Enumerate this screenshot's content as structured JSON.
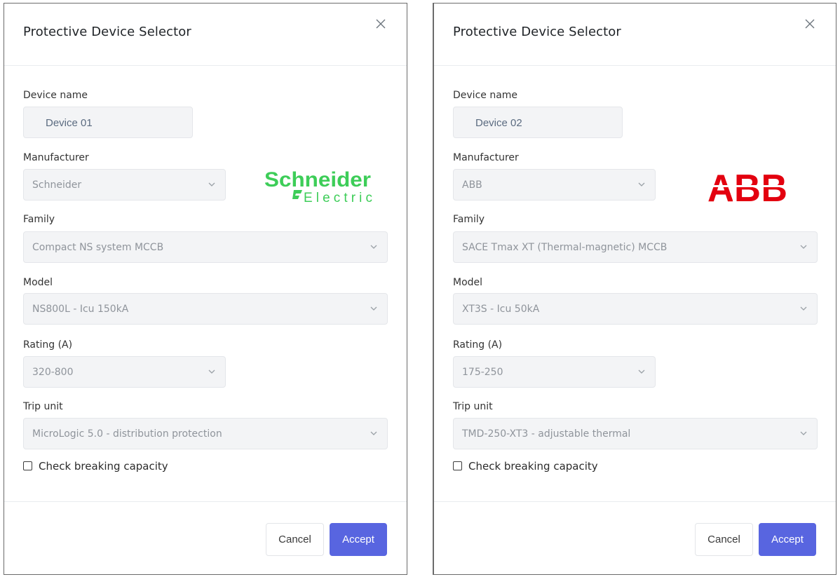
{
  "colors": {
    "accent": "#5865e0",
    "schneider_green": "#3dcd58",
    "abb_red": "#e3000f"
  },
  "dialogs": [
    {
      "title": "Protective Device Selector",
      "device_name_label": "Device name",
      "device_name_value": "Device 01",
      "manufacturer_label": "Manufacturer",
      "manufacturer_value": "Schneider",
      "manufacturer_logo": {
        "name": "schneider-electric-logo",
        "line1": "Schneider",
        "line2": "Electric"
      },
      "family_label": "Family",
      "family_value": "Compact NS system MCCB",
      "model_label": "Model",
      "model_value": "NS800L - Icu 150kA",
      "rating_label": "Rating (A)",
      "rating_value": "320-800",
      "trip_unit_label": "Trip unit",
      "trip_unit_value": "MicroLogic 5.0 - distribution protection",
      "check_label": "Check breaking capacity",
      "cancel_label": "Cancel",
      "accept_label": "Accept"
    },
    {
      "title": "Protective Device Selector",
      "device_name_label": "Device name",
      "device_name_value": "Device 02",
      "manufacturer_label": "Manufacturer",
      "manufacturer_value": "ABB",
      "manufacturer_logo": {
        "name": "abb-logo",
        "text": "ABB"
      },
      "family_label": "Family",
      "family_value": "SACE Tmax XT (Thermal-magnetic) MCCB",
      "model_label": "Model",
      "model_value": "XT3S - Icu 50kA",
      "rating_label": "Rating (A)",
      "rating_value": "175-250",
      "trip_unit_label": "Trip unit",
      "trip_unit_value": "TMD-250-XT3 - adjustable thermal",
      "check_label": "Check breaking capacity",
      "cancel_label": "Cancel",
      "accept_label": "Accept"
    }
  ]
}
